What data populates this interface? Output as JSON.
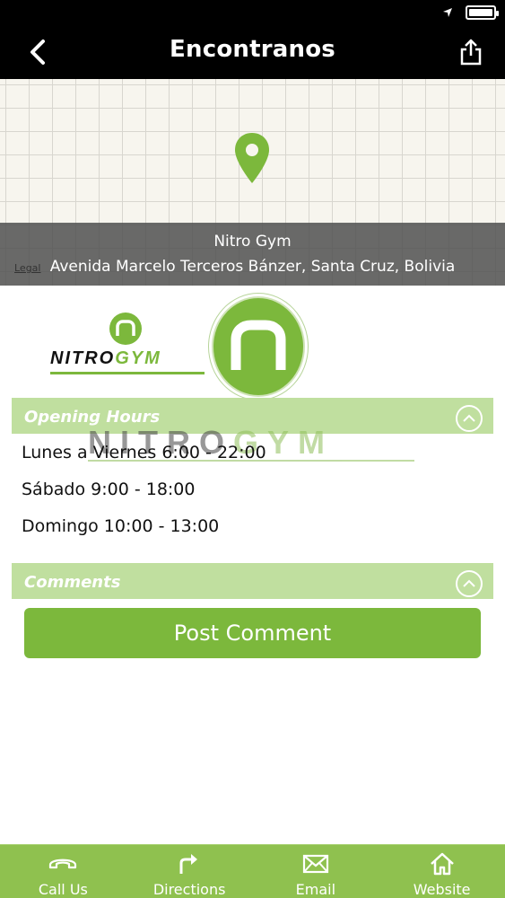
{
  "nav": {
    "title": "Encontranos"
  },
  "map": {
    "legal_label": "Legal",
    "place_name": "Nitro Gym",
    "address": "Avenida Marcelo Terceros Bánzer, Santa Cruz, Bolivia"
  },
  "logo": {
    "nitro": "NITRO",
    "gym": "GYM"
  },
  "opening_hours": {
    "title": "Opening Hours",
    "rows": [
      "Lunes a Viernes 6:00 - 22:00",
      "Sábado 9:00 - 18:00",
      "Domingo 10:00 - 13:00"
    ]
  },
  "comments": {
    "title": "Comments",
    "post_label": "Post Comment"
  },
  "tabs": [
    {
      "label": "Call Us",
      "icon": "phone-icon"
    },
    {
      "label": "Directions",
      "icon": "directions-icon"
    },
    {
      "label": "Email",
      "icon": "email-icon"
    },
    {
      "label": "Website",
      "icon": "home-icon"
    }
  ],
  "colors": {
    "accent": "#7cb83c",
    "header_bg": "#000000",
    "section_bg": "#c0df9f",
    "tab_bar_bg": "#8fc14f"
  }
}
